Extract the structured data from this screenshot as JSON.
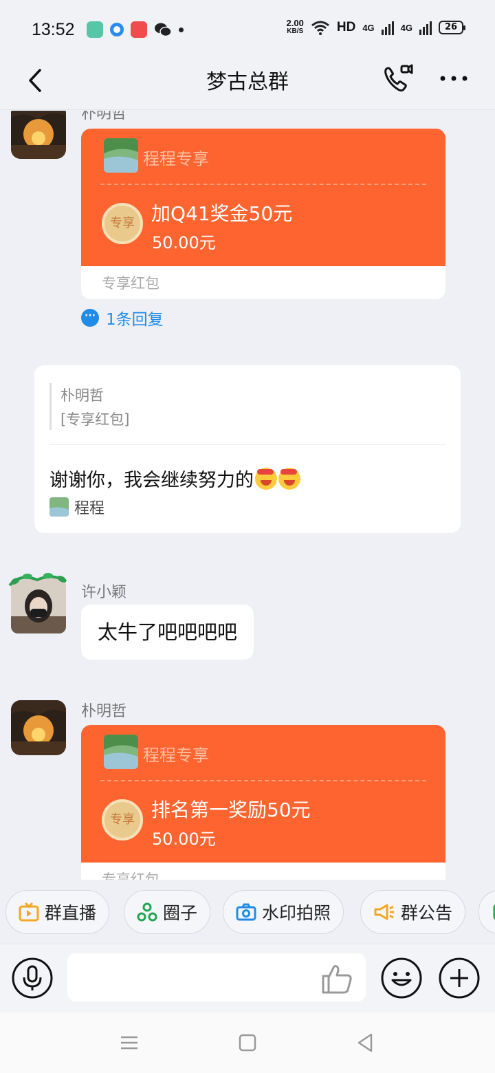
{
  "status_bar": {
    "time": "13:52",
    "net_speed_value": "2.00",
    "net_speed_unit": "KB/S",
    "hd": "HD",
    "signal1": "4G",
    "signal2": "4G",
    "battery": "26"
  },
  "header": {
    "title": "梦古总群",
    "back_icon": "back-arrow-icon",
    "call_icon": "phone-video-icon",
    "more_icon": "more-dots-icon"
  },
  "messages": [
    {
      "sender": "朴明哲",
      "type": "red_packet",
      "exclusive_for": "程程专享",
      "coin_label": "专享",
      "title": "加Q41奖金50元",
      "amount": "50.00元",
      "footer": "专享红包",
      "reply_count": "1条回复"
    },
    {
      "type": "quoted_reply",
      "quote_name": "朴明哲",
      "quote_text": "[专享红包]",
      "text": "谢谢你，我会继续努力的",
      "from": "程程"
    },
    {
      "sender": "许小颖",
      "type": "text",
      "text": "太牛了吧吧吧吧"
    },
    {
      "sender": "朴明哲",
      "type": "red_packet",
      "exclusive_for": "程程专享",
      "coin_label": "专享",
      "title": "排名第一奖励50元",
      "amount": "50.00元",
      "footer": "专享红包"
    }
  ],
  "quick_actions": [
    {
      "label": "群直播",
      "icon": "live-tv-icon"
    },
    {
      "label": "圈子",
      "icon": "circle-group-icon"
    },
    {
      "label": "水印拍照",
      "icon": "camera-icon"
    },
    {
      "label": "群公告",
      "icon": "megaphone-icon"
    }
  ],
  "input": {
    "placeholder": ""
  },
  "colors": {
    "red_packet": "#fe6430",
    "link": "#1f8ce8",
    "background": "#eef0f5"
  }
}
